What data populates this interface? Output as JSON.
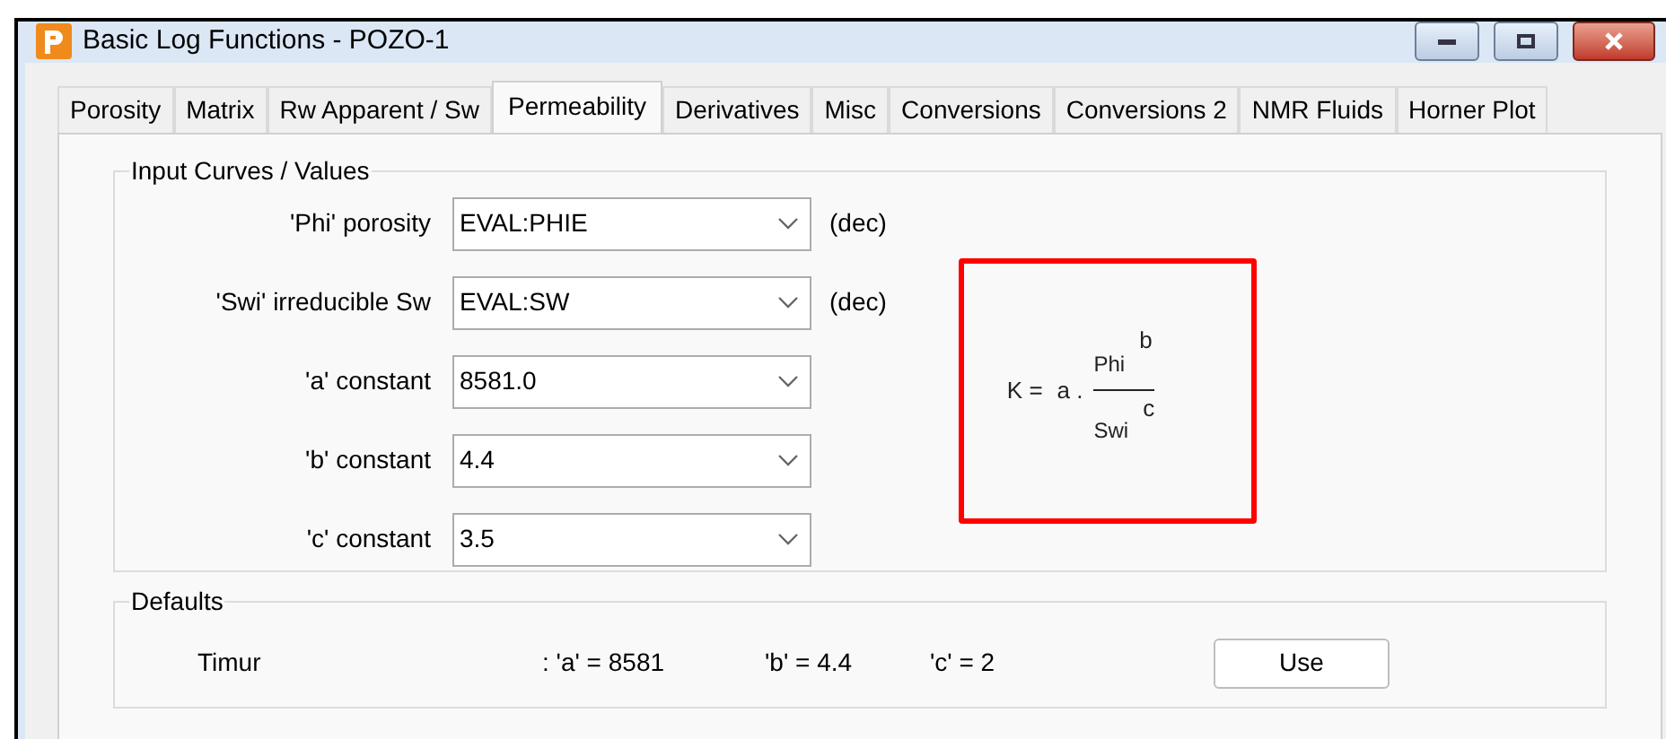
{
  "window": {
    "title": "Basic Log Functions - POZO-1"
  },
  "tabs": [
    {
      "label": "Porosity",
      "selected": false
    },
    {
      "label": "Matrix",
      "selected": false
    },
    {
      "label": "Rw Apparent / Sw",
      "selected": false
    },
    {
      "label": "Permeability",
      "selected": true
    },
    {
      "label": "Derivatives",
      "selected": false
    },
    {
      "label": "Misc",
      "selected": false
    },
    {
      "label": "Conversions",
      "selected": false
    },
    {
      "label": "Conversions 2",
      "selected": false
    },
    {
      "label": "NMR Fluids",
      "selected": false
    },
    {
      "label": "Horner Plot",
      "selected": false
    }
  ],
  "input_group": {
    "title": "Input Curves / Values",
    "rows": [
      {
        "label": "'Phi'  porosity",
        "value": "EVAL:PHIE",
        "unit": "(dec)"
      },
      {
        "label": "'Swi' irreducible Sw",
        "value": "EVAL:SW",
        "unit": "(dec)"
      },
      {
        "label": "'a' constant",
        "value": "8581.0"
      },
      {
        "label": "'b' constant",
        "value": "4.4"
      },
      {
        "label": "'c' constant",
        "value": "3.5"
      }
    ]
  },
  "formula": {
    "lhs": "K =",
    "coefficient": "a .",
    "numerator": "Phi",
    "numerator_exponent": "b",
    "denominator": "Swi",
    "denominator_exponent": "c"
  },
  "defaults_group": {
    "title": "Defaults",
    "rows": [
      {
        "name": "Timur",
        "a": ": 'a' = 8581",
        "b": "'b' = 4.4",
        "c": "'c' = 2",
        "button": "Use"
      }
    ]
  }
}
